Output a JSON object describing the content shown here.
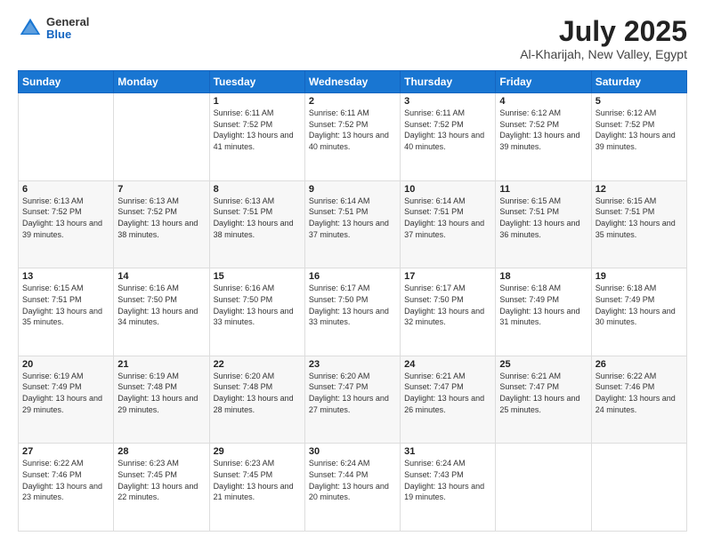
{
  "header": {
    "logo_general": "General",
    "logo_blue": "Blue",
    "month_year": "July 2025",
    "location": "Al-Kharijah, New Valley, Egypt"
  },
  "days_of_week": [
    "Sunday",
    "Monday",
    "Tuesday",
    "Wednesday",
    "Thursday",
    "Friday",
    "Saturday"
  ],
  "weeks": [
    [
      {
        "day": "",
        "info": ""
      },
      {
        "day": "",
        "info": ""
      },
      {
        "day": "1",
        "info": "Sunrise: 6:11 AM\nSunset: 7:52 PM\nDaylight: 13 hours and 41 minutes."
      },
      {
        "day": "2",
        "info": "Sunrise: 6:11 AM\nSunset: 7:52 PM\nDaylight: 13 hours and 40 minutes."
      },
      {
        "day": "3",
        "info": "Sunrise: 6:11 AM\nSunset: 7:52 PM\nDaylight: 13 hours and 40 minutes."
      },
      {
        "day": "4",
        "info": "Sunrise: 6:12 AM\nSunset: 7:52 PM\nDaylight: 13 hours and 39 minutes."
      },
      {
        "day": "5",
        "info": "Sunrise: 6:12 AM\nSunset: 7:52 PM\nDaylight: 13 hours and 39 minutes."
      }
    ],
    [
      {
        "day": "6",
        "info": "Sunrise: 6:13 AM\nSunset: 7:52 PM\nDaylight: 13 hours and 39 minutes."
      },
      {
        "day": "7",
        "info": "Sunrise: 6:13 AM\nSunset: 7:52 PM\nDaylight: 13 hours and 38 minutes."
      },
      {
        "day": "8",
        "info": "Sunrise: 6:13 AM\nSunset: 7:51 PM\nDaylight: 13 hours and 38 minutes."
      },
      {
        "day": "9",
        "info": "Sunrise: 6:14 AM\nSunset: 7:51 PM\nDaylight: 13 hours and 37 minutes."
      },
      {
        "day": "10",
        "info": "Sunrise: 6:14 AM\nSunset: 7:51 PM\nDaylight: 13 hours and 37 minutes."
      },
      {
        "day": "11",
        "info": "Sunrise: 6:15 AM\nSunset: 7:51 PM\nDaylight: 13 hours and 36 minutes."
      },
      {
        "day": "12",
        "info": "Sunrise: 6:15 AM\nSunset: 7:51 PM\nDaylight: 13 hours and 35 minutes."
      }
    ],
    [
      {
        "day": "13",
        "info": "Sunrise: 6:15 AM\nSunset: 7:51 PM\nDaylight: 13 hours and 35 minutes."
      },
      {
        "day": "14",
        "info": "Sunrise: 6:16 AM\nSunset: 7:50 PM\nDaylight: 13 hours and 34 minutes."
      },
      {
        "day": "15",
        "info": "Sunrise: 6:16 AM\nSunset: 7:50 PM\nDaylight: 13 hours and 33 minutes."
      },
      {
        "day": "16",
        "info": "Sunrise: 6:17 AM\nSunset: 7:50 PM\nDaylight: 13 hours and 33 minutes."
      },
      {
        "day": "17",
        "info": "Sunrise: 6:17 AM\nSunset: 7:50 PM\nDaylight: 13 hours and 32 minutes."
      },
      {
        "day": "18",
        "info": "Sunrise: 6:18 AM\nSunset: 7:49 PM\nDaylight: 13 hours and 31 minutes."
      },
      {
        "day": "19",
        "info": "Sunrise: 6:18 AM\nSunset: 7:49 PM\nDaylight: 13 hours and 30 minutes."
      }
    ],
    [
      {
        "day": "20",
        "info": "Sunrise: 6:19 AM\nSunset: 7:49 PM\nDaylight: 13 hours and 29 minutes."
      },
      {
        "day": "21",
        "info": "Sunrise: 6:19 AM\nSunset: 7:48 PM\nDaylight: 13 hours and 29 minutes."
      },
      {
        "day": "22",
        "info": "Sunrise: 6:20 AM\nSunset: 7:48 PM\nDaylight: 13 hours and 28 minutes."
      },
      {
        "day": "23",
        "info": "Sunrise: 6:20 AM\nSunset: 7:47 PM\nDaylight: 13 hours and 27 minutes."
      },
      {
        "day": "24",
        "info": "Sunrise: 6:21 AM\nSunset: 7:47 PM\nDaylight: 13 hours and 26 minutes."
      },
      {
        "day": "25",
        "info": "Sunrise: 6:21 AM\nSunset: 7:47 PM\nDaylight: 13 hours and 25 minutes."
      },
      {
        "day": "26",
        "info": "Sunrise: 6:22 AM\nSunset: 7:46 PM\nDaylight: 13 hours and 24 minutes."
      }
    ],
    [
      {
        "day": "27",
        "info": "Sunrise: 6:22 AM\nSunset: 7:46 PM\nDaylight: 13 hours and 23 minutes."
      },
      {
        "day": "28",
        "info": "Sunrise: 6:23 AM\nSunset: 7:45 PM\nDaylight: 13 hours and 22 minutes."
      },
      {
        "day": "29",
        "info": "Sunrise: 6:23 AM\nSunset: 7:45 PM\nDaylight: 13 hours and 21 minutes."
      },
      {
        "day": "30",
        "info": "Sunrise: 6:24 AM\nSunset: 7:44 PM\nDaylight: 13 hours and 20 minutes."
      },
      {
        "day": "31",
        "info": "Sunrise: 6:24 AM\nSunset: 7:43 PM\nDaylight: 13 hours and 19 minutes."
      },
      {
        "day": "",
        "info": ""
      },
      {
        "day": "",
        "info": ""
      }
    ]
  ]
}
